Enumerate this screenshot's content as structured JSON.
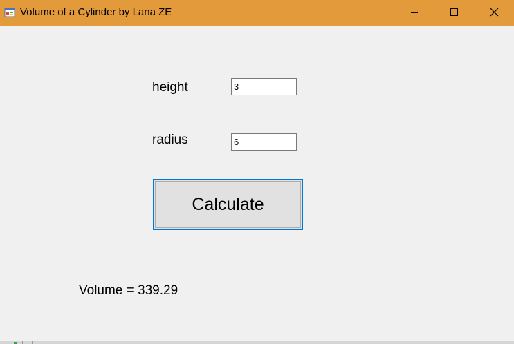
{
  "window": {
    "title": "Volume of a Cylinder by Lana ZE",
    "titlebar_color": "#e29a3a",
    "controls": {
      "minimize_icon": "minimize-icon",
      "maximize_icon": "maximize-icon",
      "close_icon": "close-icon"
    }
  },
  "form": {
    "height_label": "height",
    "height_value": "3",
    "radius_label": "radius",
    "radius_value": "6",
    "calculate_label": "Calculate",
    "calculate_border_color": "#0078d7",
    "result_text": "Volume = 339.29"
  }
}
